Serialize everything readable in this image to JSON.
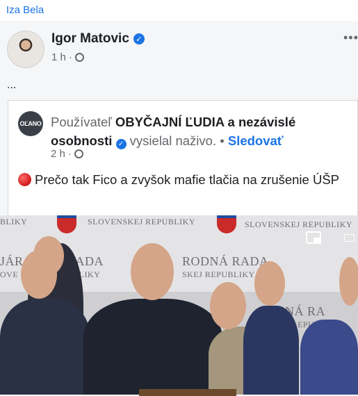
{
  "sharer_name": "Iza Bela",
  "post": {
    "author": "Igor Matovic",
    "time": "1 h",
    "more": "•••",
    "text": "..."
  },
  "shared": {
    "page_badge": "OĽANO",
    "title_prefix": "Používateľ",
    "page_name": "OBYČAJNÍ ĽUDIA a nezávislé osobnosti",
    "action": "vysielal naživo.",
    "separator": "•",
    "follow": "Sledovať",
    "time": "2 h",
    "text": "Prečo tak Fico a zvyšok mafie tlačia na zrušenie ÚŠP"
  },
  "video": {
    "background_text": [
      "BLIKY",
      "SLOVENSKEJ REPUBLIKY",
      "SLOVENSKEJ REPUBLIKY",
      "JÁR",
      "RADA",
      "OVE",
      "UBLIKY",
      "RODNÁ RADA",
      "SKEJ REPUBLIKY",
      "NÁ RA",
      "EPUBL"
    ]
  },
  "colors": {
    "accent": "#1b74e4",
    "live_dot": "#d01818",
    "text_secondary": "#65676b"
  }
}
